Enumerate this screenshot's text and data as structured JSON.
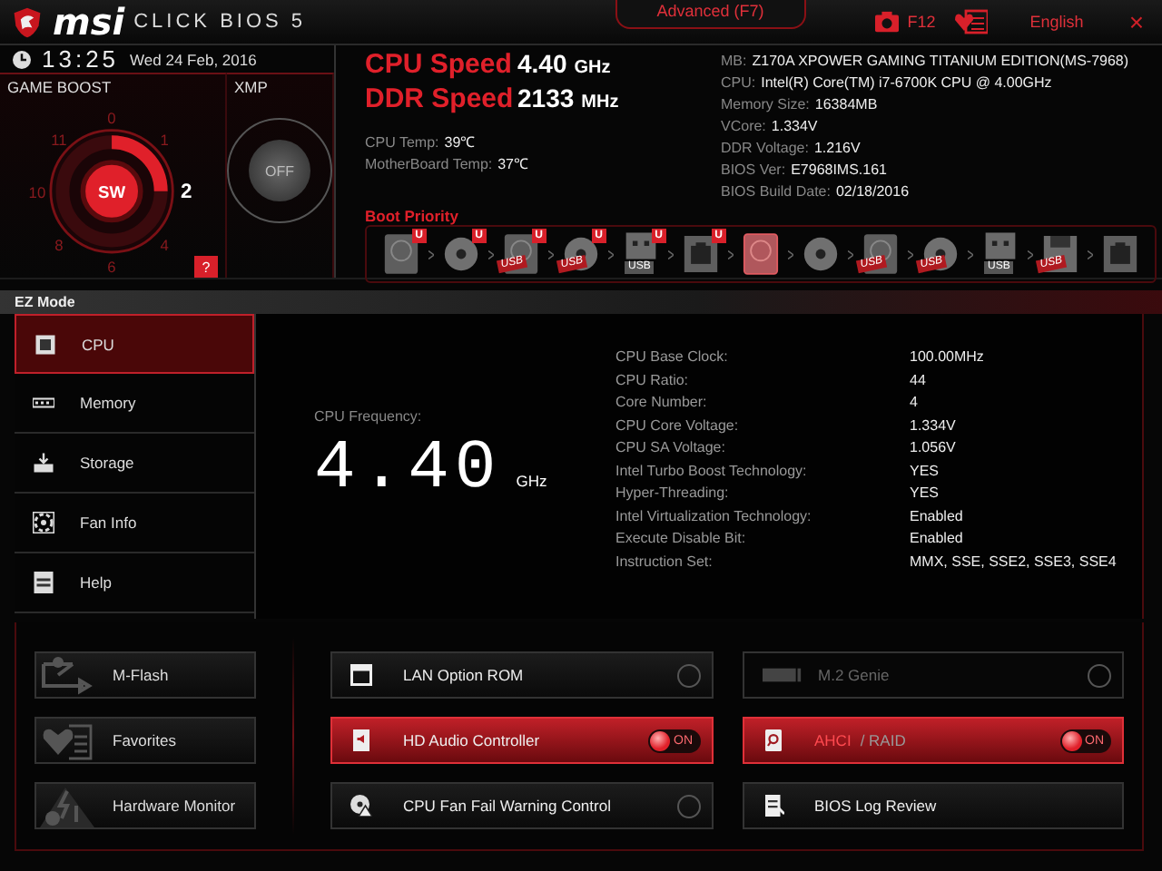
{
  "header": {
    "brand": "msi",
    "product": "CLICK BIOS 5",
    "mode_tab": "Advanced (F7)",
    "screenshot_key": "F12",
    "language": "English",
    "close": "×"
  },
  "clock": {
    "time": "13:25",
    "date": "Wed 24 Feb, 2016"
  },
  "game_boost": {
    "title": "GAME BOOST",
    "knob": "SW",
    "help": "?",
    "marks": [
      {
        "label": "0",
        "selected": false
      },
      {
        "label": "1",
        "selected": false
      },
      {
        "label": "2",
        "selected": true
      },
      {
        "label": "4",
        "selected": false
      },
      {
        "label": "6",
        "selected": false
      },
      {
        "label": "8",
        "selected": false
      },
      {
        "label": "10",
        "selected": false
      },
      {
        "label": "11",
        "selected": false
      }
    ]
  },
  "xmp": {
    "title": "XMP",
    "knob": "OFF",
    "on": false
  },
  "speeds": [
    {
      "label": "CPU Speed",
      "value": "4.40",
      "unit": "GHz"
    },
    {
      "label": "DDR Speed",
      "value": "2133",
      "unit": "MHz"
    }
  ],
  "temps": [
    {
      "label": "CPU Temp:",
      "value": "39℃"
    },
    {
      "label": "MotherBoard Temp:",
      "value": "37℃"
    }
  ],
  "system_info": [
    {
      "label": "MB:",
      "value": "Z170A XPOWER GAMING TITANIUM EDITION(MS-7968)"
    },
    {
      "label": "CPU:",
      "value": "Intel(R) Core(TM) i7-6700K CPU @ 4.00GHz"
    },
    {
      "label": "Memory Size:",
      "value": "16384MB"
    },
    {
      "label": "VCore:",
      "value": "1.334V"
    },
    {
      "label": "DDR Voltage:",
      "value": "1.216V"
    },
    {
      "label": "BIOS Ver:",
      "value": "E7968IMS.161"
    },
    {
      "label": "BIOS Build Date:",
      "value": "02/18/2016"
    }
  ],
  "boot_priority": {
    "title": "Boot Priority",
    "devices": [
      {
        "kind": "hdd",
        "badge": "U",
        "highlighted": false
      },
      {
        "kind": "optical",
        "badge": "U",
        "highlighted": false
      },
      {
        "kind": "hdd",
        "badge": "U",
        "tag": "USB",
        "highlighted": false
      },
      {
        "kind": "optical",
        "badge": "U",
        "tag": "USB",
        "highlighted": false
      },
      {
        "kind": "usb-key",
        "badge": "U",
        "tag": "USB",
        "highlighted": false
      },
      {
        "kind": "lan",
        "badge": "U",
        "highlighted": false
      },
      {
        "kind": "hdd",
        "highlighted": true
      },
      {
        "kind": "optical",
        "highlighted": false
      },
      {
        "kind": "hdd",
        "tag": "USB",
        "highlighted": false
      },
      {
        "kind": "optical",
        "tag": "USB",
        "highlighted": false
      },
      {
        "kind": "usb-key",
        "tag": "USB",
        "highlighted": false
      },
      {
        "kind": "floppy",
        "tag": "USB",
        "highlighted": false
      },
      {
        "kind": "lan",
        "highlighted": false
      }
    ]
  },
  "ez_mode": {
    "title": "EZ Mode"
  },
  "sidebar": {
    "items": [
      {
        "kind": "cpu",
        "label": "CPU",
        "selected": true
      },
      {
        "kind": "memory",
        "label": "Memory",
        "selected": false
      },
      {
        "kind": "storage",
        "label": "Storage",
        "selected": false
      },
      {
        "kind": "fan",
        "label": "Fan Info",
        "selected": false
      },
      {
        "kind": "help",
        "label": "Help",
        "selected": false
      }
    ]
  },
  "cpu_panel": {
    "frequency_label": "CPU Frequency:",
    "frequency": "4.40",
    "frequency_unit": "GHz",
    "details": [
      {
        "label": "CPU Base Clock:",
        "value": "100.00MHz"
      },
      {
        "label": "CPU Ratio:",
        "value": "44"
      },
      {
        "label": "Core Number:",
        "value": "4"
      },
      {
        "label": "CPU Core Voltage:",
        "value": "1.334V"
      },
      {
        "label": "CPU SA Voltage:",
        "value": "1.056V"
      },
      {
        "label": "Intel Turbo Boost Technology:",
        "value": "YES"
      },
      {
        "label": "Hyper-Threading:",
        "value": "YES"
      },
      {
        "label": "Intel Virtualization Technology:",
        "value": "Enabled"
      },
      {
        "label": "Execute Disable Bit:",
        "value": "Enabled"
      },
      {
        "label": "Instruction Set:",
        "value": "MMX, SSE, SSE2, SSE3, SSE4"
      }
    ]
  },
  "tools": [
    {
      "kind": "flash",
      "label": "M-Flash"
    },
    {
      "kind": "favorites",
      "label": "Favorites"
    },
    {
      "kind": "monitor",
      "label": "Hardware Monitor"
    }
  ],
  "features": [
    {
      "kind": "lan",
      "label": "LAN Option ROM",
      "on": false,
      "disabled": false
    },
    {
      "kind": "m2",
      "label": "M.2 Genie",
      "on": false,
      "disabled": true
    },
    {
      "kind": "audio",
      "label": "HD Audio Controller",
      "on": true,
      "disabled": false,
      "switch_label": "ON"
    },
    {
      "kind": "disk",
      "label": "AHCI",
      "label_suffix": "/ RAID",
      "on": true,
      "disabled": false,
      "switch_label": "ON"
    },
    {
      "kind": "fan",
      "label": "CPU Fan Fail Warning Control",
      "on": false,
      "disabled": false
    },
    {
      "kind": "log",
      "label": "BIOS Log Review",
      "disabled": false
    }
  ]
}
